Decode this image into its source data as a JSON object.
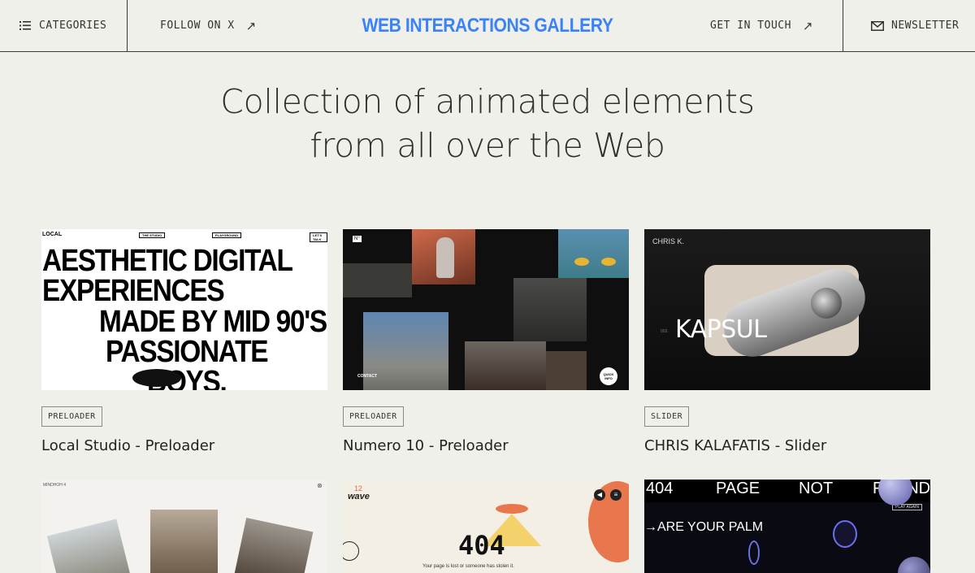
{
  "header": {
    "categories": "CATEGORIES",
    "follow": "FOLLOW ON X",
    "brand": "WEB INTERACTIONS GALLERY",
    "touch": "GET IN TOUCH",
    "newsletter": "NEWSLETTER"
  },
  "hero": {
    "line1": "Collection of animated elements",
    "line2": "from all over the Web"
  },
  "cards": [
    {
      "tag": "PRELOADER",
      "title": "Local Studio - Preloader",
      "thumb": {
        "logo": "LOCAL",
        "nav": [
          "THE STUDIO",
          "PLAYGROUND",
          "LET'S TALK"
        ],
        "lines": [
          "AESTHETIC DIGITAL",
          "EXPERIENCES",
          "MADE BY MID 90'S",
          "PASSIONATE",
          "BOYS."
        ]
      }
    },
    {
      "tag": "PRELOADER",
      "title": "Numero 10 - Preloader",
      "thumb": {
        "logo": "N°",
        "contact": "CONTACT",
        "badge": "QUICK\nINFO"
      }
    },
    {
      "tag": "SLIDER",
      "title": "CHRIS KALAFATIS - Slider",
      "thumb": {
        "logo": "CHRIS K.",
        "product": "KAPSUL",
        "index": "003."
      }
    },
    {
      "thumb": {
        "header": "MINDHOH 4"
      }
    },
    {
      "thumb": {
        "logo_top": "12",
        "logo": "wave",
        "code": "404",
        "caption": "Your page is lost or someone has stolen it."
      }
    },
    {
      "thumb": {
        "words": [
          "404",
          "PAGE",
          "NOT",
          "FOUND"
        ],
        "headline": "→ARE YOUR PALM",
        "button": "PLAY AGAIN"
      }
    }
  ],
  "colors": {
    "background": "#f0f0eb",
    "brand": "#3b82f6",
    "text": "#2a2a2a"
  },
  "icons": {
    "categories": "list-icon",
    "follow": "arrow-up-right-icon",
    "touch": "arrow-up-right-icon",
    "newsletter": "mail-icon"
  }
}
